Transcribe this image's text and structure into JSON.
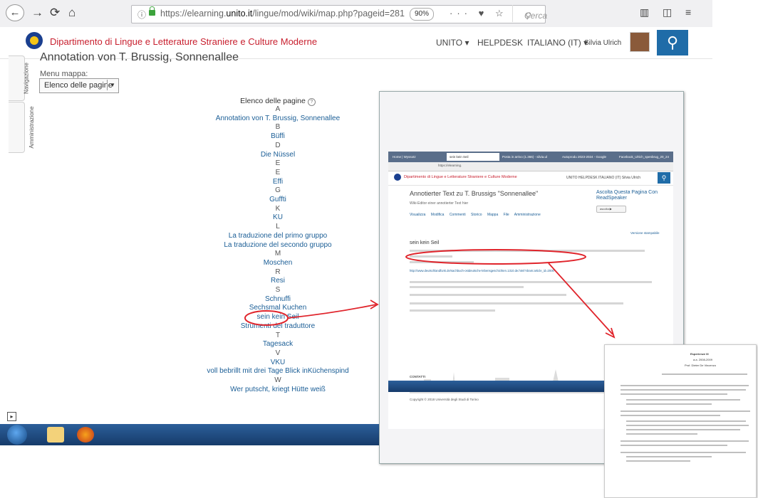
{
  "browser": {
    "url_prefix": "https://elearning.",
    "url_domain": "unito.it",
    "url_path": "/lingue/mod/wiki/map.php?pageid=281",
    "zoom": "90%",
    "search_placeholder": "Cerca",
    "more": "···"
  },
  "header": {
    "site_name": "Dipartimento di Lingue e Letterature Straniere e Culture Moderne",
    "nav": [
      "UNITO ▾",
      "HELPDESK",
      "ITALIANO (IT) ▾"
    ],
    "user": "Silvia Ulrich"
  },
  "side_tabs": [
    "Navigazione",
    "Amministrazione"
  ],
  "page": {
    "title": "Annotation von T. Brussig, Sonnenallee",
    "menu_label": "Menu mappa:",
    "menu_value": "Elenco delle pagine",
    "list_heading": "Elenco delle pagine",
    "list": [
      {
        "text": "A",
        "link": false
      },
      {
        "text": "Annotation von T. Brussig, Sonnenallee",
        "link": true
      },
      {
        "text": "B",
        "link": false
      },
      {
        "text": "Büffi",
        "link": true
      },
      {
        "text": "D",
        "link": false
      },
      {
        "text": "Die Nüssel",
        "link": true
      },
      {
        "text": "E",
        "link": false
      },
      {
        "text": "E",
        "link": false
      },
      {
        "text": "Effi",
        "link": true
      },
      {
        "text": "G",
        "link": false
      },
      {
        "text": "Guffti",
        "link": true
      },
      {
        "text": "K",
        "link": false
      },
      {
        "text": "KU",
        "link": true
      },
      {
        "text": "L",
        "link": false
      },
      {
        "text": "La traduzione del primo gruppo",
        "link": true
      },
      {
        "text": "La traduzione del secondo gruppo",
        "link": true
      },
      {
        "text": "M",
        "link": false
      },
      {
        "text": "Moschen",
        "link": true
      },
      {
        "text": "R",
        "link": false
      },
      {
        "text": "Resi",
        "link": true
      },
      {
        "text": "S",
        "link": false
      },
      {
        "text": "Schnuffi",
        "link": true
      },
      {
        "text": "Sechsmal Kuchen",
        "link": true
      },
      {
        "text": "sein kein Seil",
        "link": true
      },
      {
        "text": "Strumenti del traduttore",
        "link": true
      },
      {
        "text": "T",
        "link": false
      },
      {
        "text": "Tagesack",
        "link": true
      },
      {
        "text": "V",
        "link": false
      },
      {
        "text": "VKU",
        "link": true
      },
      {
        "text": "voll bebrillt mit drei Tage Blick inKüchenspind",
        "link": true
      },
      {
        "text": "W",
        "link": false
      },
      {
        "text": "Wer putscht, kriegt Hütte weiß",
        "link": true
      }
    ]
  },
  "overlay_screenshot": {
    "tabs": [
      "Home | Wyssotz",
      "sein kein Seil",
      "Posta in arrivo (1.366) - silvia.ul",
      "Autoprodu 2023-2024 - Google",
      "Facebook_Ulrich_spenbrug_20_24"
    ],
    "site_name": "Dipartimento di Lingue e Letterature Straniere e Culture Moderne",
    "nav": "UNITO  HELPDESK  ITALIANO (IT)  Silvia Ulrich",
    "title": "Annotierter Text zu T. Brussigs \"Sonnenallee\"",
    "subtitle": "Wiki-Editor einer annotierter Text hier",
    "tabs_row": "Visualizza Modifica Commenti Storico Mappa File Amministrazione",
    "read_speaker": "Ascolta Questa Pagina Con ReadSpeaker",
    "print": "Versione stampabile",
    "heading": "sein kein Seil",
    "link": "http://www.deutschlandfunk.de/sachbuch-ostdeutsche-lebensgeschichten.1310.de.html?dram:article_id=2000",
    "contacts": "CONTATTI",
    "copyright": "Copyright © 2018 Università degli Studi di Torino"
  },
  "overlay_document": {
    "heading": "Esperienze III",
    "year": "a.a. 2008-2009",
    "teacher": "Prof. Dieter De Vincenzo"
  },
  "colors": {
    "brand_red": "#c8202f",
    "link_blue": "#1b5e96",
    "search_blue": "#1f6ca8",
    "annotation_red": "#e0242b"
  }
}
